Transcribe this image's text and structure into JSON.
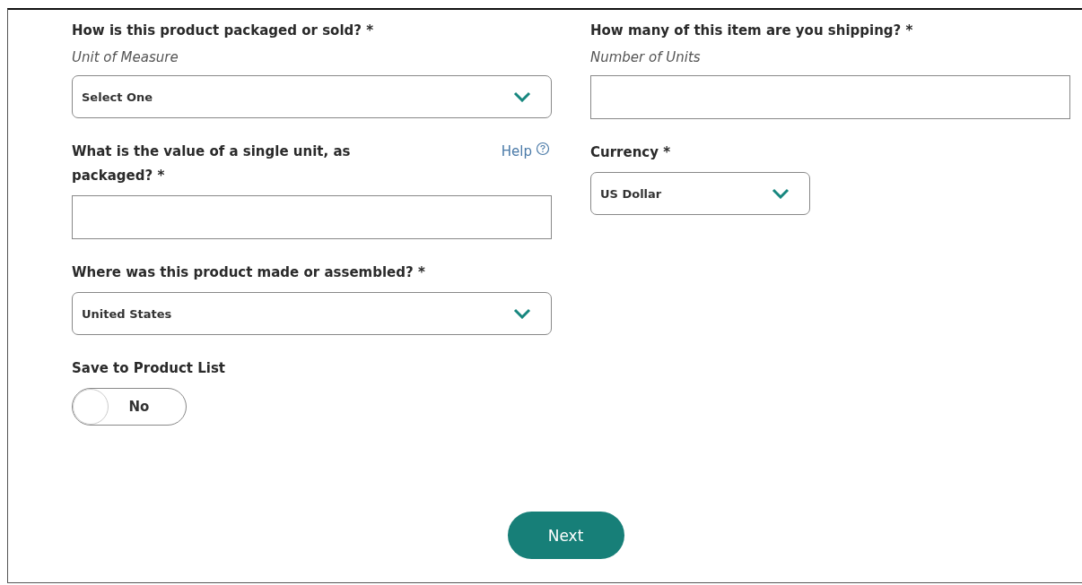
{
  "left_fields": [
    {
      "kind": "select",
      "label": "How is this product packaged or sold? *",
      "hint": "Unit of Measure",
      "value": "Select One"
    },
    {
      "kind": "text",
      "label": "What is the value of a single unit, as packaged? *",
      "help": "Help"
    },
    {
      "kind": "select",
      "label": "Where was this product made or assembled? *",
      "value": "United States"
    }
  ],
  "right_fields": [
    {
      "kind": "text",
      "label": "How many of this item are you shipping? *",
      "hint": "Number of Units"
    },
    {
      "kind": "short_select",
      "label": "Currency *",
      "value": "US Dollar"
    }
  ],
  "save_toggle": {
    "label": "Save to Product List",
    "on": false,
    "state_text": "No"
  },
  "next_button": "Next"
}
